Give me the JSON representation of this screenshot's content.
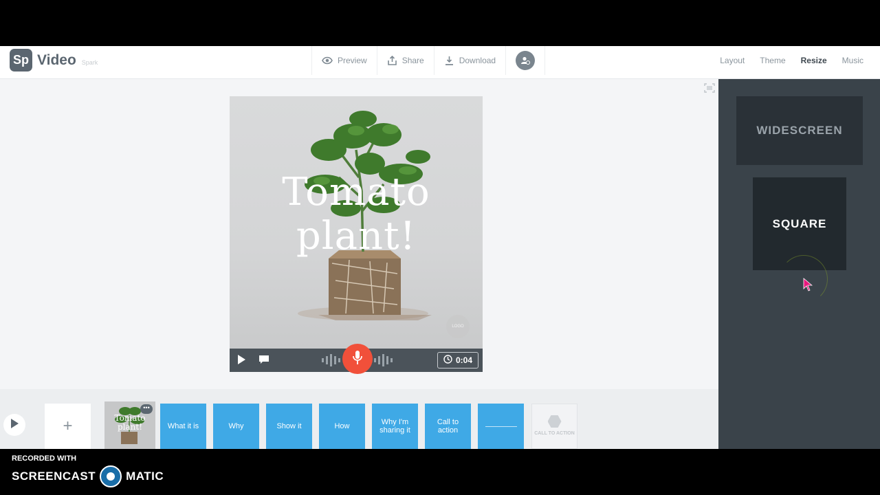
{
  "app": {
    "logo_badge": "Sp",
    "name": "Video",
    "sub": "Spark"
  },
  "header": {
    "actions": [
      {
        "label": "Preview",
        "icon": "eye-icon"
      },
      {
        "label": "Share",
        "icon": "share-icon"
      },
      {
        "label": "Download",
        "icon": "download-icon"
      }
    ],
    "menu": [
      {
        "label": "Layout"
      },
      {
        "label": "Theme"
      },
      {
        "label": "Resize",
        "active": true
      },
      {
        "label": "Music"
      }
    ]
  },
  "slide": {
    "title": "Tomato plant!",
    "logo_placeholder": "LOGO"
  },
  "player": {
    "time": "0:04"
  },
  "side_panel": {
    "options": [
      "WIDESCREEN",
      "SQUARE"
    ],
    "selected": "SQUARE"
  },
  "timeline": {
    "add_label": "+",
    "thumb_title": "Tomato plant!",
    "scenes": [
      "What it is",
      "Why",
      "Show it",
      "How",
      "Why I'm sharing it",
      "Call to action",
      ""
    ],
    "logo_label": "CALL TO ACTION"
  },
  "recorder": {
    "label": "RECORDED WITH",
    "brand_left": "SCREENCAST",
    "brand_right": "MATIC"
  },
  "colors": {
    "accent_blue": "#3fa9e6",
    "mic_red": "#f1503a",
    "panel": "#3a434a"
  }
}
